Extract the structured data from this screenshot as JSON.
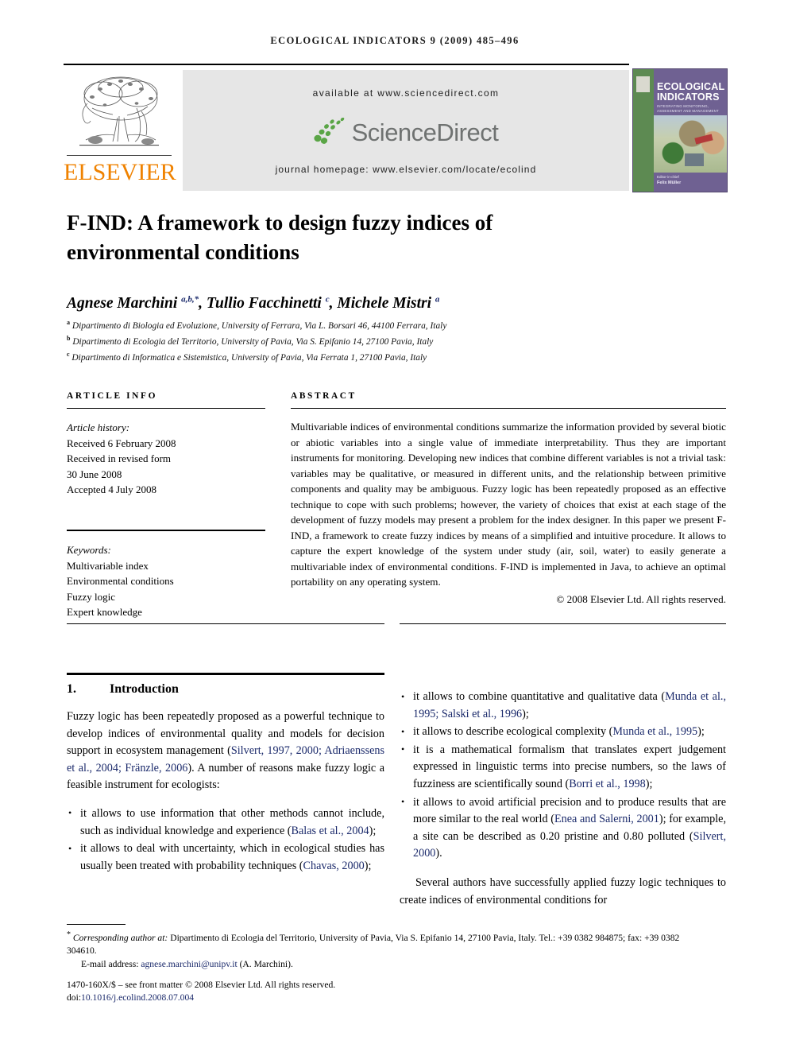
{
  "running_head": "ECOLOGICAL INDICATORS 9 (2009) 485–496",
  "masthead": {
    "publisher": "ELSEVIER",
    "available_at": "available at www.sciencedirect.com",
    "sciencedirect_word": "ScienceDirect",
    "journal_homepage": "journal homepage: www.elsevier.com/locate/ecolind",
    "cover": {
      "title": "ECOLOGICAL INDICATORS",
      "subtitle": "INTEGRATING MONITORING, ASSESSMENT AND MANAGEMENT",
      "editor_label": "Editor-in-chief",
      "editor_name": "Felix Müller"
    }
  },
  "article": {
    "title": "F-IND: A framework to design fuzzy indices of environmental conditions",
    "authors_html": "Agnese Marchini <sup>a,b,*</sup>, Tullio Facchinetti <sup>c</sup>, Michele Mistri <sup>a</sup>",
    "affiliations": [
      "Dipartimento di Biologia ed Evoluzione, University of Ferrara, Via L. Borsari 46, 44100 Ferrara, Italy",
      "Dipartimento di Ecologia del Territorio, University of Pavia, Via S. Epifanio 14, 27100 Pavia, Italy",
      "Dipartimento di Informatica e Sistemistica, University of Pavia, Via Ferrata 1, 27100 Pavia, Italy"
    ],
    "affiliation_marks": [
      "a",
      "b",
      "c"
    ]
  },
  "article_info": {
    "heading": "ARTICLE INFO",
    "history_label": "Article history:",
    "history_lines": [
      "Received 6 February 2008",
      "Received in revised form",
      "30 June 2008",
      "Accepted 4 July 2008"
    ],
    "keywords_label": "Keywords:",
    "keywords": [
      "Multivariable index",
      "Environmental conditions",
      "Fuzzy logic",
      "Expert knowledge"
    ]
  },
  "abstract": {
    "heading": "ABSTRACT",
    "text": "Multivariable indices of environmental conditions summarize the information provided by several biotic or abiotic variables into a single value of immediate interpretability. Thus they are important instruments for monitoring. Developing new indices that combine different variables is not a trivial task: variables may be qualitative, or measured in different units, and the relationship between primitive components and quality may be ambiguous. Fuzzy logic has been repeatedly proposed as an effective technique to cope with such problems; however, the variety of choices that exist at each stage of the development of fuzzy models may present a problem for the index designer. In this paper we present F-IND, a framework to create fuzzy indices by means of a simplified and intuitive procedure. It allows to capture the expert knowledge of the system under study (air, soil, water) to easily generate a multivariable index of environmental conditions. F-IND is implemented in Java, to achieve an optimal portability on any operating system.",
    "copyright": "© 2008 Elsevier Ltd. All rights reserved."
  },
  "body": {
    "section_number": "1.",
    "section_title": "Introduction",
    "intro_paragraph_html": "Fuzzy logic has been repeatedly proposed as a powerful technique to develop indices of environmental quality and models for decision support in ecosystem management (<span class=\"cite\">Silvert, 1997, 2000; Adriaenssens et al., 2004; Fränzle, 2006</span>). A number of reasons make fuzzy logic a feasible instrument for ecologists:",
    "bullets_left_html": [
      "it allows to use information that other methods cannot include, such as individual knowledge and experience (<span class=\"cite\">Balas et al., 2004</span>);",
      "it allows to deal with uncertainty, which in ecological studies has usually been treated with probability techniques (<span class=\"cite\">Chavas, 2000</span>);"
    ],
    "bullets_right_html": [
      "it allows to combine quantitative and qualitative data (<span class=\"cite\">Munda et al., 1995; Salski et al., 1996</span>);",
      "it allows to describe ecological complexity (<span class=\"cite\">Munda et al., 1995</span>);",
      "it is a mathematical formalism that translates expert judgement expressed in linguistic terms into precise numbers, so the laws of fuzziness are scientifically sound (<span class=\"cite\">Borri et al., 1998</span>);",
      "it allows to avoid artificial precision and to produce results that are more similar to the real world (<span class=\"cite\">Enea and Salerni, 2001</span>); for example, a site can be described as 0.20 pristine and 0.80 polluted (<span class=\"cite\">Silvert, 2000</span>)."
    ],
    "closing_paragraph": "Several authors have successfully applied fuzzy logic techniques to create indices of environmental conditions for"
  },
  "footer": {
    "corresponding_html": "<span class=\"star\">*</span> <span class=\"ital\">Corresponding author at:</span> Dipartimento di Ecologia del Territorio, University of Pavia, Via S. Epifanio 14, 27100 Pavia, Italy. Tel.: +39 0382 984875; fax: +39 0382 304610.",
    "email_html": "E-mail address: <span class=\"link\">agnese.marchini@unipv.it</span> (A. Marchini).",
    "issn_line": "1470-160X/$ – see front matter © 2008 Elsevier Ltd. All rights reserved.",
    "doi_label": "doi:",
    "doi_value": "10.1016/j.ecolind.2008.07.004"
  },
  "colors": {
    "elsevier_orange": "#ef8200",
    "citation_blue": "#1b2a6b",
    "sciencedirect_green": "#5aa546",
    "sciencedirect_gray": "#6f7271",
    "masthead_box_gray": "#e6e6e6",
    "cover_purple": "#6f6192",
    "cover_green": "#5d8a52"
  }
}
